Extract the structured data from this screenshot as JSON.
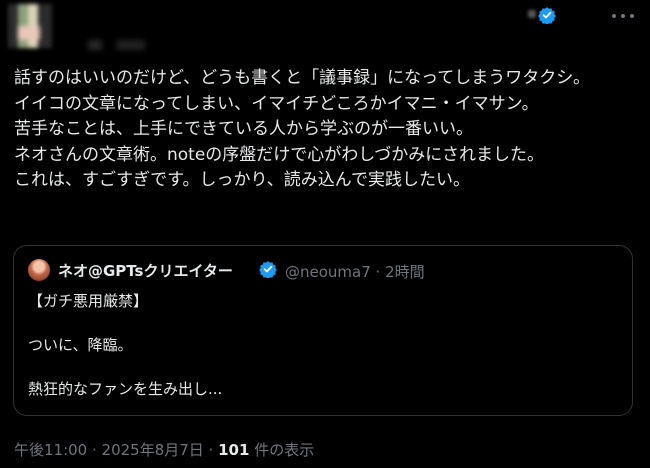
{
  "tweet": {
    "text": "話すのはいいのだけど、どうも書くと「議事録」になってしまうワタクシ。\nイイコの文章になってしまい、イマイチどころかイマニ・イマサン。\n苦手なことは、上手にできている人から学ぶのが一番いい。\nネオさんの文章術。noteの序盤だけで心がわしづかみにされました。\nこれは、すごすぎです。しっかり、読み込んで実践したい。",
    "verified_icon": "verified-badge-icon",
    "more_icon": "more-options-icon"
  },
  "quote": {
    "author_name": "ネオ@GPTsクリエイター",
    "meta": "@neouma7 · 2時間",
    "text": "【ガチ悪用厳禁】\n\nついに、降臨。\n\n熱狂的なファンを生み出し...",
    "verified_icon": "verified-badge-icon"
  },
  "footer": {
    "timestamp": "午後11:00 · 2025年8月7日 · ",
    "views_count": "101",
    "views_label": " 件の表示"
  },
  "colors": {
    "background": "#000000",
    "text": "#e7e9ea",
    "secondary_text": "#71767b",
    "border": "#2f3336",
    "verified": "#1d9bf0"
  }
}
